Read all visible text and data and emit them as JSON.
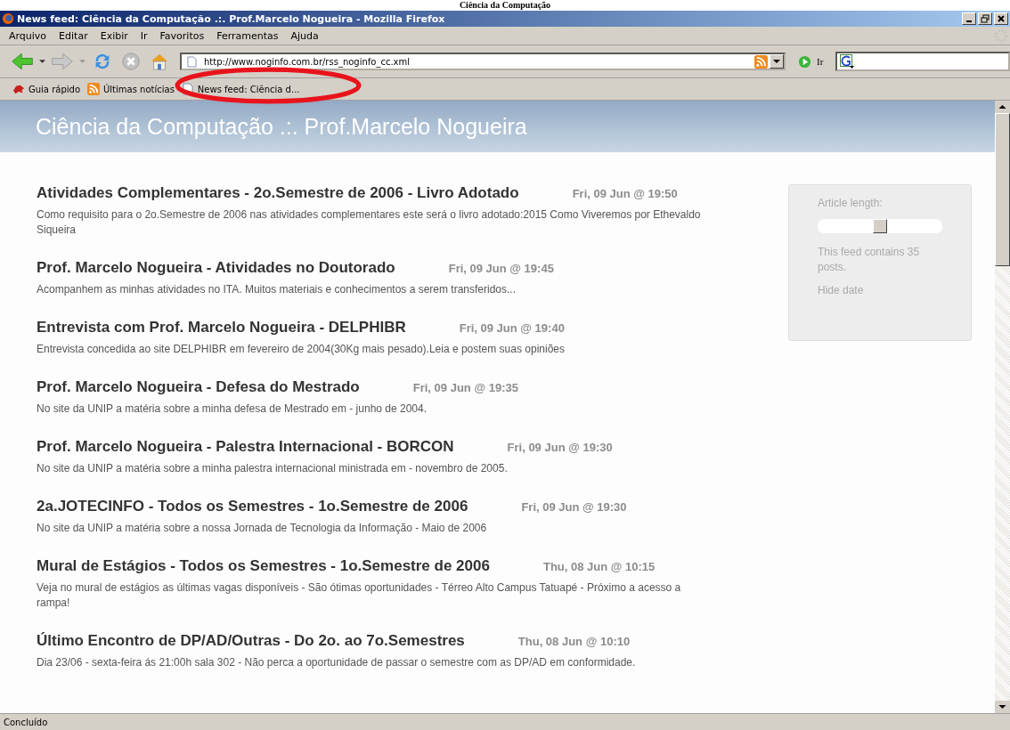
{
  "document_heading": "Ciência da Computação",
  "window": {
    "title": "News feed: Ciência da Computação .:. Prof.Marcelo Nogueira - Mozilla Firefox"
  },
  "menu": [
    "Arquivo",
    "Editar",
    "Exibir",
    "Ir",
    "Favoritos",
    "Ferramentas",
    "Ajuda"
  ],
  "toolbar": {
    "url": "http://www.noginfo.com.br/rss_noginfo_cc.xml",
    "go_label": "Ir"
  },
  "bookmarks": [
    {
      "label": "Guia rápido",
      "kind": "site"
    },
    {
      "label": "Últimas notícias",
      "kind": "rss"
    },
    {
      "label": "News feed: Ciência d...",
      "kind": "page"
    }
  ],
  "feed": {
    "title": "Ciência da Computação .:. Prof.Marcelo Nogueira",
    "items": [
      {
        "title": "Atividades Complementares - 2o.Semestre de 2006 - Livro Adotado",
        "date": "Fri, 09 Jun @ 19:50",
        "summary": "Como requisito para o 2o.Semestre de 2006 nas atividades complementares este será o livro adotado:2015 Como Viveremos por Ethevaldo Siqueira"
      },
      {
        "title": "Prof. Marcelo Nogueira - Atividades no Doutorado",
        "date": "Fri, 09 Jun @ 19:45",
        "summary": "Acompanhem as minhas atividades no ITA. Muitos materiais e conhecimentos a serem transferidos..."
      },
      {
        "title": "Entrevista com Prof. Marcelo Nogueira - DELPHIBR",
        "date": "Fri, 09 Jun @ 19:40",
        "summary": "Entrevista concedida ao site DELPHIBR em fevereiro de 2004(30Kg mais pesado).Leia e postem suas opiniões"
      },
      {
        "title": "Prof. Marcelo Nogueira - Defesa do Mestrado",
        "date": "Fri, 09 Jun @ 19:35",
        "summary": "No site da UNIP a matéria sobre a minha defesa de Mestrado em - junho de 2004."
      },
      {
        "title": "Prof. Marcelo Nogueira - Palestra Internacional - BORCON",
        "date": "Fri, 09 Jun @ 19:30",
        "summary": "No site da UNIP a matéria sobre a minha palestra internacional ministrada em - novembro de 2005."
      },
      {
        "title": "2a.JOTECINFO - Todos os Semestres - 1o.Semestre de 2006",
        "date": "Fri, 09 Jun @ 19:30",
        "summary": "No site da UNIP a matéria sobre a nossa Jornada de Tecnologia da Informação - Maio de 2006"
      },
      {
        "title": "Mural de Estágios - Todos os Semestres - 1o.Semestre de 2006",
        "date": "Thu, 08 Jun @ 10:15",
        "summary": "Veja no mural de estágios as últimas vagas disponíveis - São ótimas oportunidades - Térreo Alto Campus Tatuapé - Próximo a acesso a rampa!"
      },
      {
        "title": "Último Encontro de DP/AD/Outras - Do 2o. ao 7o.Semestres",
        "date": "Thu, 08 Jun @ 10:10",
        "summary": "Dia 23/06 - sexta-feira ás 21:00h sala 302 - Não perca a oportunidade de passar o semestre com as DP/AD em conformidade."
      }
    ]
  },
  "sidebar": {
    "length_label": "Article length:",
    "slider": {
      "level": 0.5
    },
    "post_count": "This feed contains 35 posts.",
    "hide_date": "Hide date"
  },
  "status_bar": "Concluído"
}
